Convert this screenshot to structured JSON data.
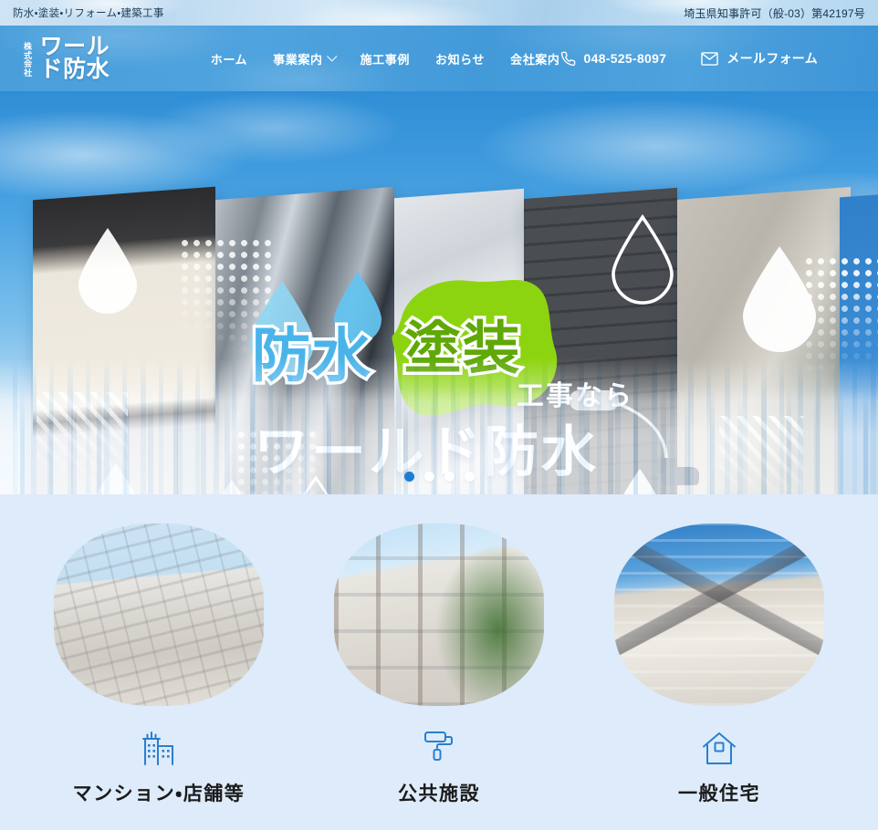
{
  "topbar": {
    "tagline": "防水・塗装・リフォーム・建築工事",
    "license": "埼玉県知事許可（般-03）第42197号"
  },
  "header": {
    "logo": {
      "prefix_line1": "株式",
      "prefix_line2": "会社",
      "name": "ワールド防水"
    },
    "nav": [
      {
        "label": "ホーム",
        "has_dropdown": false
      },
      {
        "label": "事業案内",
        "has_dropdown": true
      },
      {
        "label": "施工事例",
        "has_dropdown": false
      },
      {
        "label": "お知らせ",
        "has_dropdown": false
      },
      {
        "label": "会社案内",
        "has_dropdown": false
      }
    ],
    "contact": {
      "phone": "048-525-8097",
      "mail_label": "メールフォーム"
    }
  },
  "hero": {
    "word_waterproof": "防水",
    "word_painting": "塗装",
    "word_if": "工事なら",
    "company": "ワールド防水",
    "carousel": {
      "total": 4,
      "active_index": 0
    }
  },
  "services": [
    {
      "label": "マンション・店舗等",
      "icon": "building-icon"
    },
    {
      "label": "公共施設",
      "icon": "paint-roller-icon"
    },
    {
      "label": "一般住宅",
      "icon": "house-icon"
    }
  ],
  "colors": {
    "header_blue": "#4a9fdb",
    "accent_blue": "#1a7fd4",
    "icon_blue": "#2a7fd0",
    "splash_green": "#8dd410",
    "text_green": "#5fa806",
    "text_blue": "#4ab4ea",
    "section_bg": "#ddebfa"
  }
}
